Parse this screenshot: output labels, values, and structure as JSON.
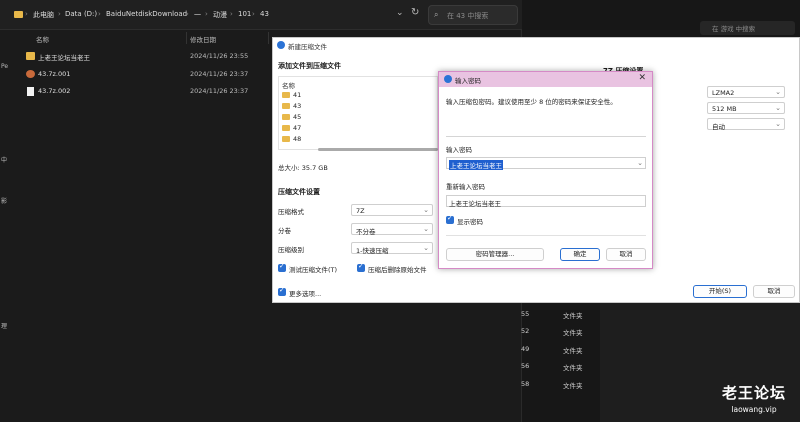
{
  "explorer": {
    "breadcrumbs": [
      "此电脑",
      "Data (D:)",
      "BaiduNetdiskDownload",
      "一",
      "动漫",
      "101",
      "43"
    ],
    "search_placeholder": "在 43 中搜索",
    "columns": [
      "名称",
      "修改日期"
    ],
    "files": [
      {
        "name": "上老王论坛当老王",
        "date": "2024/11/26 23:55",
        "icon": "folder-icon"
      },
      {
        "name": "43.7z.001",
        "date": "2024/11/26 23:37",
        "icon": "archive-icon"
      },
      {
        "name": "43.7z.002",
        "date": "2024/11/26 23:37",
        "icon": "file-icon"
      }
    ],
    "left_nav_letters": [
      "Pe",
      "中",
      "影",
      "理"
    ]
  },
  "right_panel": {
    "search_placeholder": "在 游戏 中搜索",
    "rows": [
      {
        "num": "55",
        "type": "文件夹"
      },
      {
        "num": "52",
        "type": "文件夹"
      },
      {
        "num": "49",
        "type": "文件夹"
      },
      {
        "num": "56",
        "type": "文件夹"
      },
      {
        "num": "58",
        "type": "文件夹"
      }
    ]
  },
  "watermark": {
    "line1": "老王论坛",
    "line2": "laowang.vip"
  },
  "archive_dialog": {
    "title": "新建压缩文件",
    "add_section": "添加文件到压缩文件",
    "list_header": "名称",
    "list_items": [
      "41",
      "43",
      "45",
      "47",
      "48"
    ],
    "total_size": "总大小: 35.7 GB",
    "settings_section": "压缩文件设置",
    "fields": [
      {
        "label": "压缩格式",
        "value": "7Z"
      },
      {
        "label": "分卷",
        "value": "不分卷"
      },
      {
        "label": "压缩级别",
        "value": "1-快速压缩"
      }
    ],
    "check_test": "测试压缩文件(T)",
    "check_delete": "压缩后删除原始文件",
    "check_more": "更多选项...",
    "right_section": "7Z 压缩设置",
    "right_values": [
      "LZMA2",
      "512 MB",
      "自动"
    ],
    "start_button": "开始(S)",
    "cancel_button": "取消"
  },
  "password_dialog": {
    "title": "输入密码",
    "description": "输入压缩包密码。建议使用至少 8 位的密码来保证安全性。",
    "password_label": "输入密码",
    "password_value": "上老王论坛当老王",
    "reenter_label": "重新输入密码",
    "reenter_value": "上老王论坛当老王",
    "show_password": "显示密码",
    "manager_button": "密码管理器...",
    "ok_button": "确定",
    "cancel_button": "取消"
  }
}
